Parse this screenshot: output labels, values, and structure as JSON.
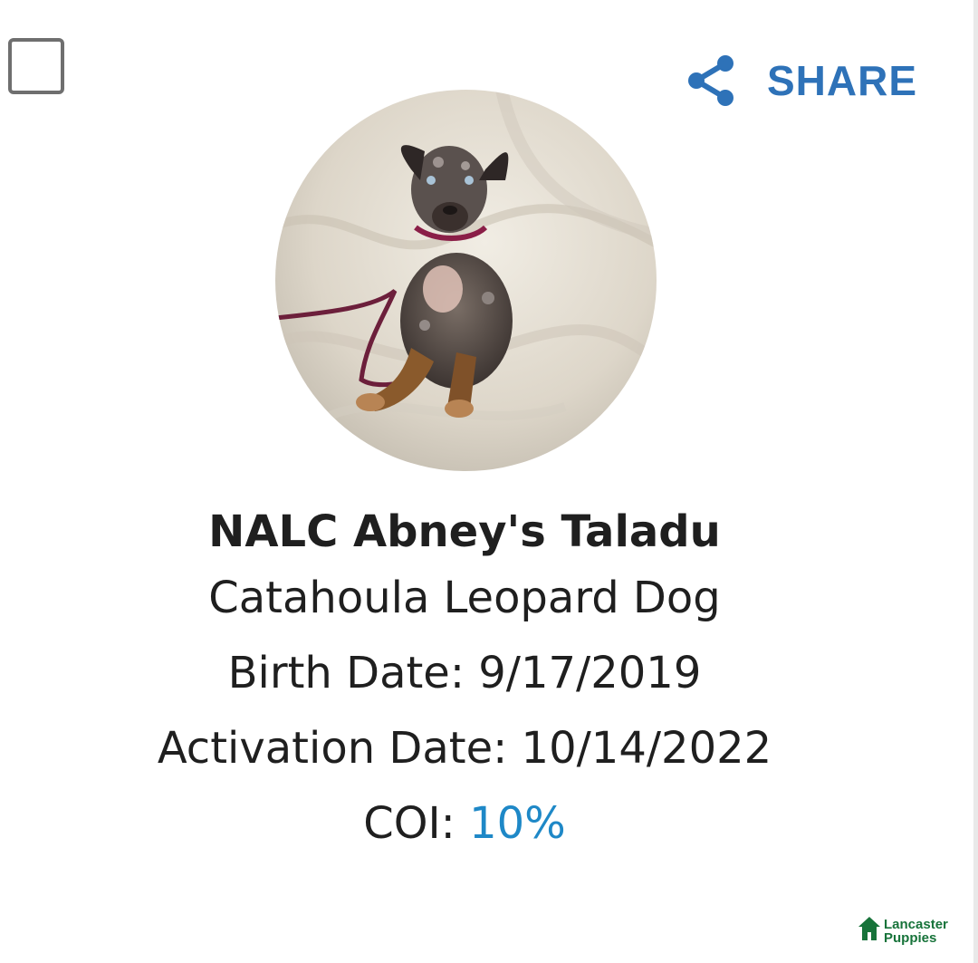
{
  "card": {
    "select_checkbox": {
      "checked": false
    },
    "share": {
      "label": "SHARE",
      "icon": "share-icon",
      "color": "#2e72b8"
    },
    "photo": {
      "alt": "NALC Abney's Taladu"
    },
    "dog": {
      "name": "NALC Abney's Taladu",
      "breed": "Catahoula Leopard Dog",
      "birth_date": "Birth Date: 9/17/2019",
      "activation_date": "Activation Date: 10/14/2022",
      "coi_label": "COI:",
      "coi_value": "10%",
      "coi_color": "#1e88c7"
    }
  },
  "brand": {
    "line1": "Lancaster",
    "line2": "Puppies",
    "icon": "lancaster-puppies-logo-icon",
    "color": "#17733a"
  }
}
